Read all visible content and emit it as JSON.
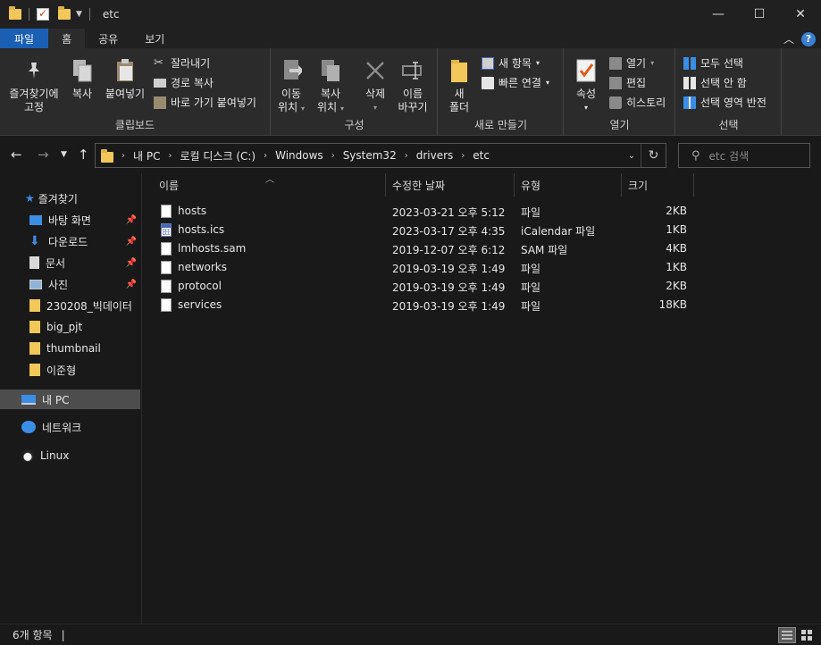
{
  "window": {
    "title": "etc",
    "minimize": "—",
    "maximize": "☐",
    "close": "✕"
  },
  "ribbon_tabs": [
    "파일",
    "홈",
    "공유",
    "보기"
  ],
  "ribbon": {
    "clipboard": {
      "pin": "즐겨찾기에 고정",
      "pin_line1": "즐겨찾기에",
      "pin_line2": "고정",
      "copy": "복사",
      "paste": "붙여넣기",
      "cut": "잘라내기",
      "copy_path": "경로 복사",
      "paste_shortcut": "바로 가기 붙여넣기",
      "label": "클립보드"
    },
    "organize": {
      "move_line1": "이동",
      "move_line2": "위치",
      "copy_line1": "복사",
      "copy_line2": "위치",
      "delete": "삭제",
      "rename_line1": "이름",
      "rename_line2": "바꾸기",
      "label": "구성"
    },
    "new": {
      "folder_line1": "새",
      "folder_line2": "폴더",
      "new_item": "새 항목",
      "easy_access": "빠른 연결",
      "label": "새로 만들기"
    },
    "open": {
      "properties": "속성",
      "open": "열기",
      "edit": "편집",
      "history": "히스토리",
      "label": "열기"
    },
    "select": {
      "select_all": "모두 선택",
      "select_none": "선택 안 함",
      "invert": "선택 영역 반전",
      "label": "선택"
    }
  },
  "address": {
    "crumbs": [
      "내 PC",
      "로컬 디스크 (C:)",
      "Windows",
      "System32",
      "drivers",
      "etc"
    ],
    "search_placeholder": "etc 검색"
  },
  "sidebar": {
    "quick_access": "즐겨찾기",
    "items": [
      {
        "label": "바탕 화면",
        "icon": "desktop-icon",
        "pinned": true
      },
      {
        "label": "다운로드",
        "icon": "download-icon",
        "pinned": true
      },
      {
        "label": "문서",
        "icon": "document-icon",
        "pinned": true
      },
      {
        "label": "사진",
        "icon": "pictures-icon",
        "pinned": true
      },
      {
        "label": "230208_빅데이터",
        "icon": "folder-icon",
        "pinned": false
      },
      {
        "label": "big_pjt",
        "icon": "folder-icon",
        "pinned": false
      },
      {
        "label": "thumbnail",
        "icon": "folder-icon",
        "pinned": false
      },
      {
        "label": "이준형",
        "icon": "folder-icon",
        "pinned": false
      }
    ],
    "this_pc": "내 PC",
    "network": "네트워크",
    "linux": "Linux"
  },
  "columns": [
    "이름",
    "수정한 날짜",
    "유형",
    "크기"
  ],
  "files": [
    {
      "name": "hosts",
      "date": "2023-03-21 오후 5:12",
      "type": "파일",
      "size": "2KB",
      "icon": "file-icon"
    },
    {
      "name": "hosts.ics",
      "date": "2023-03-17 오후 4:35",
      "type": "iCalendar 파일",
      "size": "1KB",
      "icon": "calendar-file-icon"
    },
    {
      "name": "lmhosts.sam",
      "date": "2019-12-07 오후 6:12",
      "type": "SAM 파일",
      "size": "4KB",
      "icon": "file-icon"
    },
    {
      "name": "networks",
      "date": "2019-03-19 오후 1:49",
      "type": "파일",
      "size": "1KB",
      "icon": "file-icon"
    },
    {
      "name": "protocol",
      "date": "2019-03-19 오후 1:49",
      "type": "파일",
      "size": "2KB",
      "icon": "file-icon"
    },
    {
      "name": "services",
      "date": "2019-03-19 오후 1:49",
      "type": "파일",
      "size": "18KB",
      "icon": "file-icon"
    }
  ],
  "status": {
    "count": "6개 항목",
    "divider": "|"
  }
}
